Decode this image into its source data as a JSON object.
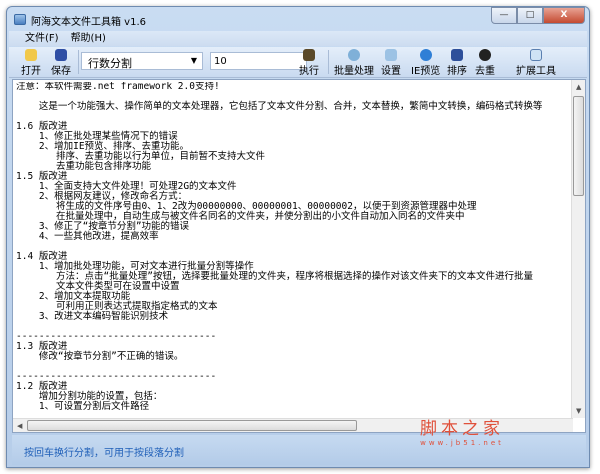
{
  "window": {
    "title": "阿海文本文件工具箱 v1.6",
    "minimize": "—",
    "maximize": "□",
    "close": "X"
  },
  "menu": [
    {
      "label": "文件(F)"
    },
    {
      "label": "帮助(H)"
    }
  ],
  "toolbar": {
    "open": "打开",
    "save": "保存",
    "mode": "行数分割",
    "value": "10",
    "execute": "执行",
    "batch": "批量处理",
    "settings": "设置",
    "ie_preview": "IE预览",
    "sort": "排序",
    "dedupe": "去重",
    "extend": "扩展工具"
  },
  "content": {
    "lines": [
      "注意：本软件需要.net framework 2.0支持!",
      "",
      "    这是一个功能强大、操作简单的文本处理器，它包括了文本文件分割、合并，文本替换，繁简中文转换，编码格式转换等",
      "",
      "1.6 版改进",
      "    1、修正批处理某些情况下的错误",
      "    2、增加IE预览、排序、去重功能。",
      "       排序、去重功能以行为单位，目前暂不支持大文件",
      "       去重功能包含排序功能",
      "1.5 版改进",
      "    1、全面支持大文件处理！可处理2G的文本文件",
      "    2、根据网友建议，修改命名方式：",
      "       将生成的文件序号由0、1、2改为00000000、00000001、00000002，以便于到资源管理器中处理",
      "       在批量处理中，自动生成与被文件名同名的文件夹，并使分割出的小文件自动加入同名的文件夹中",
      "    3、修正了“按章节分割”功能的错误",
      "    4、一些其他改进，提高效率",
      "",
      "1.4 版改进",
      "    1、增加批处理功能，可对文本进行批量分割等操作",
      "       方法：点击“批量处理”按钮，选择要批量处理的文件夹，程序将根据选择的操作对该文件夹下的文本文件进行批量",
      "       文本文件类型可在设置中设置",
      "    2、增加文本提取功能",
      "       可利用正则表达式提取指定格式的文本",
      "    3、改进文本编码智能识别技术",
      "",
      "-----------------------------------",
      "1.3 版改进",
      "    修改“按章节分割”不正确的错误。",
      "",
      "-----------------------------------",
      "1.2 版改进",
      "    增加分割功能的设置，包括：",
      "    1、可设置分割后文件路径"
    ]
  },
  "status": "按回车换行分割，可用于按段落分割",
  "watermark": {
    "name": "脚本之家",
    "url": "www.jb51.net"
  }
}
